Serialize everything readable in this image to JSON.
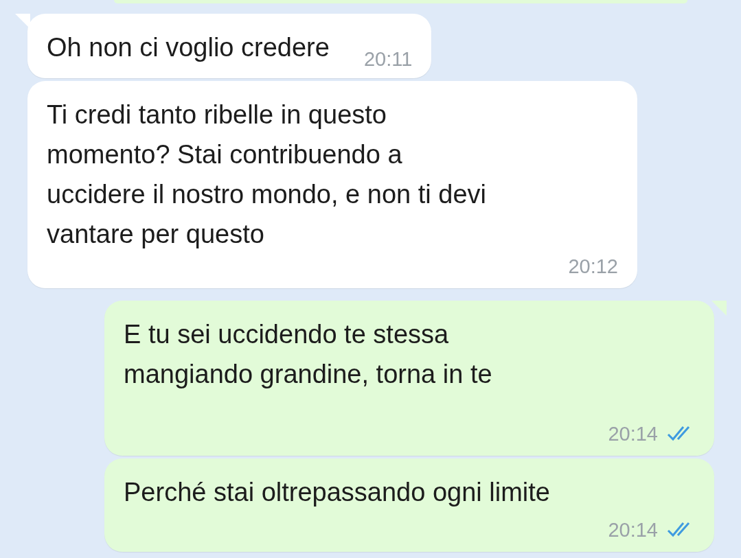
{
  "messages": [
    {
      "kind": "incoming",
      "tail": true,
      "text": "Oh non ci voglio credere",
      "time": "20:11"
    },
    {
      "kind": "incoming",
      "tail": false,
      "text": "Ti credi tanto ribelle in questo\nmomento? Stai contribuendo a\nuccidere il nostro mondo, e non ti devi\nvantare per questo",
      "time": "20:12"
    },
    {
      "kind": "outgoing",
      "tail": true,
      "text": "E tu sei uccidendo te stessa\nmangiando grandine, torna in te",
      "time": "20:14",
      "read": true
    },
    {
      "kind": "outgoing",
      "tail": false,
      "text": "Perché stai oltrepassando ogni limite",
      "time": "20:14",
      "read": true
    }
  ]
}
